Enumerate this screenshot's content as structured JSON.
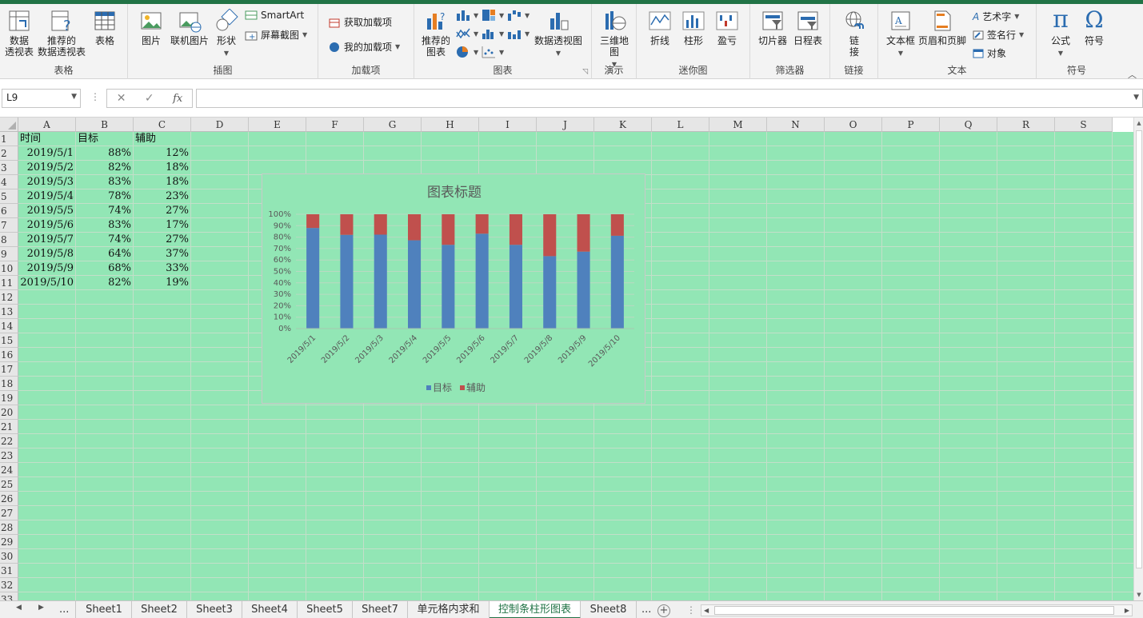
{
  "ribbon": {
    "groups": {
      "tables": "表格",
      "illustrations": "插图",
      "addins": "加载项",
      "charts": "图表",
      "tours": "演示",
      "sparklines": "迷你图",
      "filters": "筛选器",
      "links": "链接",
      "text": "文本",
      "symbols": "符号"
    },
    "buttons": {
      "pivot_table_1": "数据",
      "pivot_table_2": "透视表",
      "rec_pivot_1": "推荐的",
      "rec_pivot_2": "数据透视表",
      "table": "表格",
      "pictures": "图片",
      "online_pictures": "联机图片",
      "shapes": "形状",
      "smartart": "SmartArt",
      "screenshot": "屏幕截图",
      "get_addins": "获取加载项",
      "my_addins": "我的加载项",
      "rec_charts_1": "推荐的",
      "rec_charts_2": "图表",
      "pivot_chart": "数据透视图",
      "map3d_1": "三维地",
      "map3d_2": "图",
      "line": "折线",
      "column": "柱形",
      "winloss": "盈亏",
      "slicer": "切片器",
      "timeline": "日程表",
      "link_1": "链",
      "link_2": "接",
      "textbox": "文本框",
      "header_footer": "页眉和页脚",
      "wordart": "艺术字",
      "signature": "签名行",
      "object": "对象",
      "equation": "公式",
      "symbol": "符号"
    }
  },
  "formula_bar": {
    "name_box": "L9",
    "formula": ""
  },
  "columns": [
    "A",
    "B",
    "C",
    "D",
    "E",
    "F",
    "G",
    "H",
    "I",
    "J",
    "K",
    "L",
    "M",
    "N",
    "O",
    "P",
    "Q",
    "R",
    "S"
  ],
  "rows": [
    "1",
    "2",
    "3",
    "4",
    "5",
    "6",
    "7",
    "8",
    "9",
    "10",
    "11",
    "12",
    "13",
    "14",
    "15",
    "16",
    "17",
    "18",
    "19",
    "20",
    "21",
    "22",
    "23",
    "24",
    "25",
    "26",
    "27",
    "28",
    "29",
    "30",
    "31",
    "32",
    "33"
  ],
  "sheet": {
    "headers": [
      "时间",
      "目标",
      "辅助"
    ],
    "data": [
      [
        "2019/5/1",
        "88%",
        "12%"
      ],
      [
        "2019/5/2",
        "82%",
        "18%"
      ],
      [
        "2019/5/3",
        "83%",
        "18%"
      ],
      [
        "2019/5/4",
        "78%",
        "23%"
      ],
      [
        "2019/5/5",
        "74%",
        "27%"
      ],
      [
        "2019/5/6",
        "83%",
        "17%"
      ],
      [
        "2019/5/7",
        "74%",
        "27%"
      ],
      [
        "2019/5/8",
        "64%",
        "37%"
      ],
      [
        "2019/5/9",
        "68%",
        "33%"
      ],
      [
        "2019/5/10",
        "82%",
        "19%"
      ]
    ]
  },
  "chart_data": {
    "type": "bar",
    "stacked": "percent",
    "title": "图表标题",
    "categories": [
      "2019/5/1",
      "2019/5/2",
      "2019/5/3",
      "2019/5/4",
      "2019/5/5",
      "2019/5/6",
      "2019/5/7",
      "2019/5/8",
      "2019/5/9",
      "2019/5/10"
    ],
    "series": [
      {
        "name": "目标",
        "values": [
          88,
          82,
          83,
          78,
          74,
          83,
          74,
          64,
          68,
          82
        ],
        "color": "#4f81bd"
      },
      {
        "name": "辅助",
        "values": [
          12,
          18,
          18,
          23,
          27,
          17,
          27,
          37,
          33,
          19
        ],
        "color": "#c0504d"
      }
    ],
    "ylim": [
      0,
      100
    ],
    "yticks": [
      "0%",
      "10%",
      "20%",
      "30%",
      "40%",
      "50%",
      "60%",
      "70%",
      "80%",
      "90%",
      "100%"
    ],
    "grid": true,
    "legend": "bottom"
  },
  "tabs": {
    "items": [
      "Sheet1",
      "Sheet2",
      "Sheet3",
      "Sheet4",
      "Sheet5",
      "Sheet7",
      "单元格内求和",
      "控制条柱形图表",
      "Sheet8"
    ],
    "active": "控制条柱形图表",
    "more": "..."
  },
  "colors": {
    "accent": "#217346",
    "sheet_fill": "#92e6b5"
  }
}
